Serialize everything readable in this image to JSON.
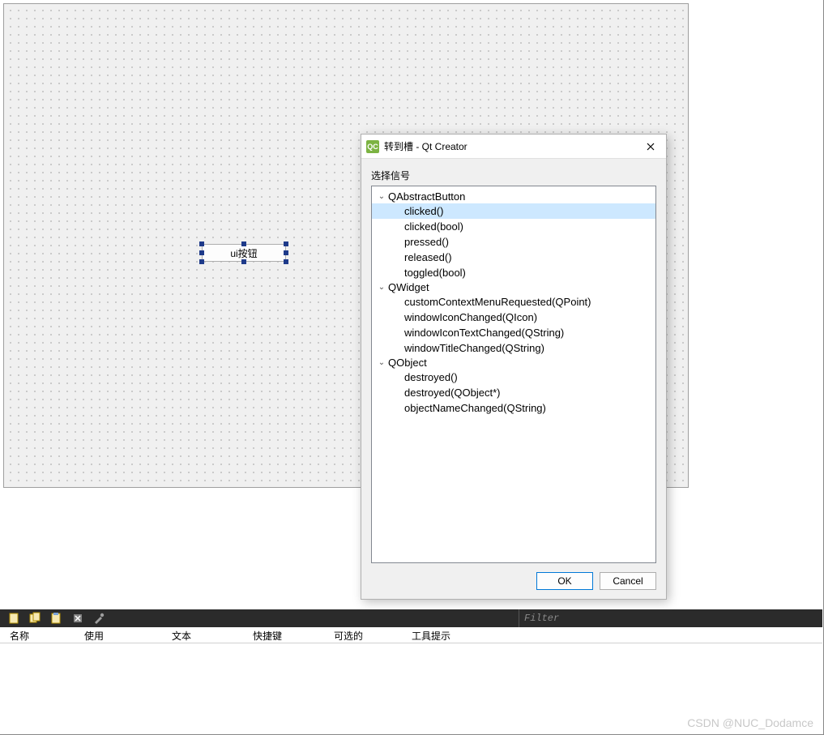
{
  "designer": {
    "button_text": "ui按钮"
  },
  "dialog": {
    "icon_label": "QC",
    "title": "转到槽 - Qt Creator",
    "select_signal_label": "选择信号",
    "groups": [
      {
        "name": "QAbstractButton",
        "signals": [
          "clicked()",
          "clicked(bool)",
          "pressed()",
          "released()",
          "toggled(bool)"
        ],
        "selected_index": 0
      },
      {
        "name": "QWidget",
        "signals": [
          "customContextMenuRequested(QPoint)",
          "windowIconChanged(QIcon)",
          "windowIconTextChanged(QString)",
          "windowTitleChanged(QString)"
        ]
      },
      {
        "name": "QObject",
        "signals": [
          "destroyed()",
          "destroyed(QObject*)",
          "objectNameChanged(QString)"
        ]
      }
    ],
    "ok_label": "OK",
    "cancel_label": "Cancel"
  },
  "filter": {
    "placeholder": "Filter"
  },
  "columns": [
    "名称",
    "使用",
    "文本",
    "快捷键",
    "可选的",
    "工具提示"
  ],
  "watermark": "CSDN @NUC_Dodamce"
}
